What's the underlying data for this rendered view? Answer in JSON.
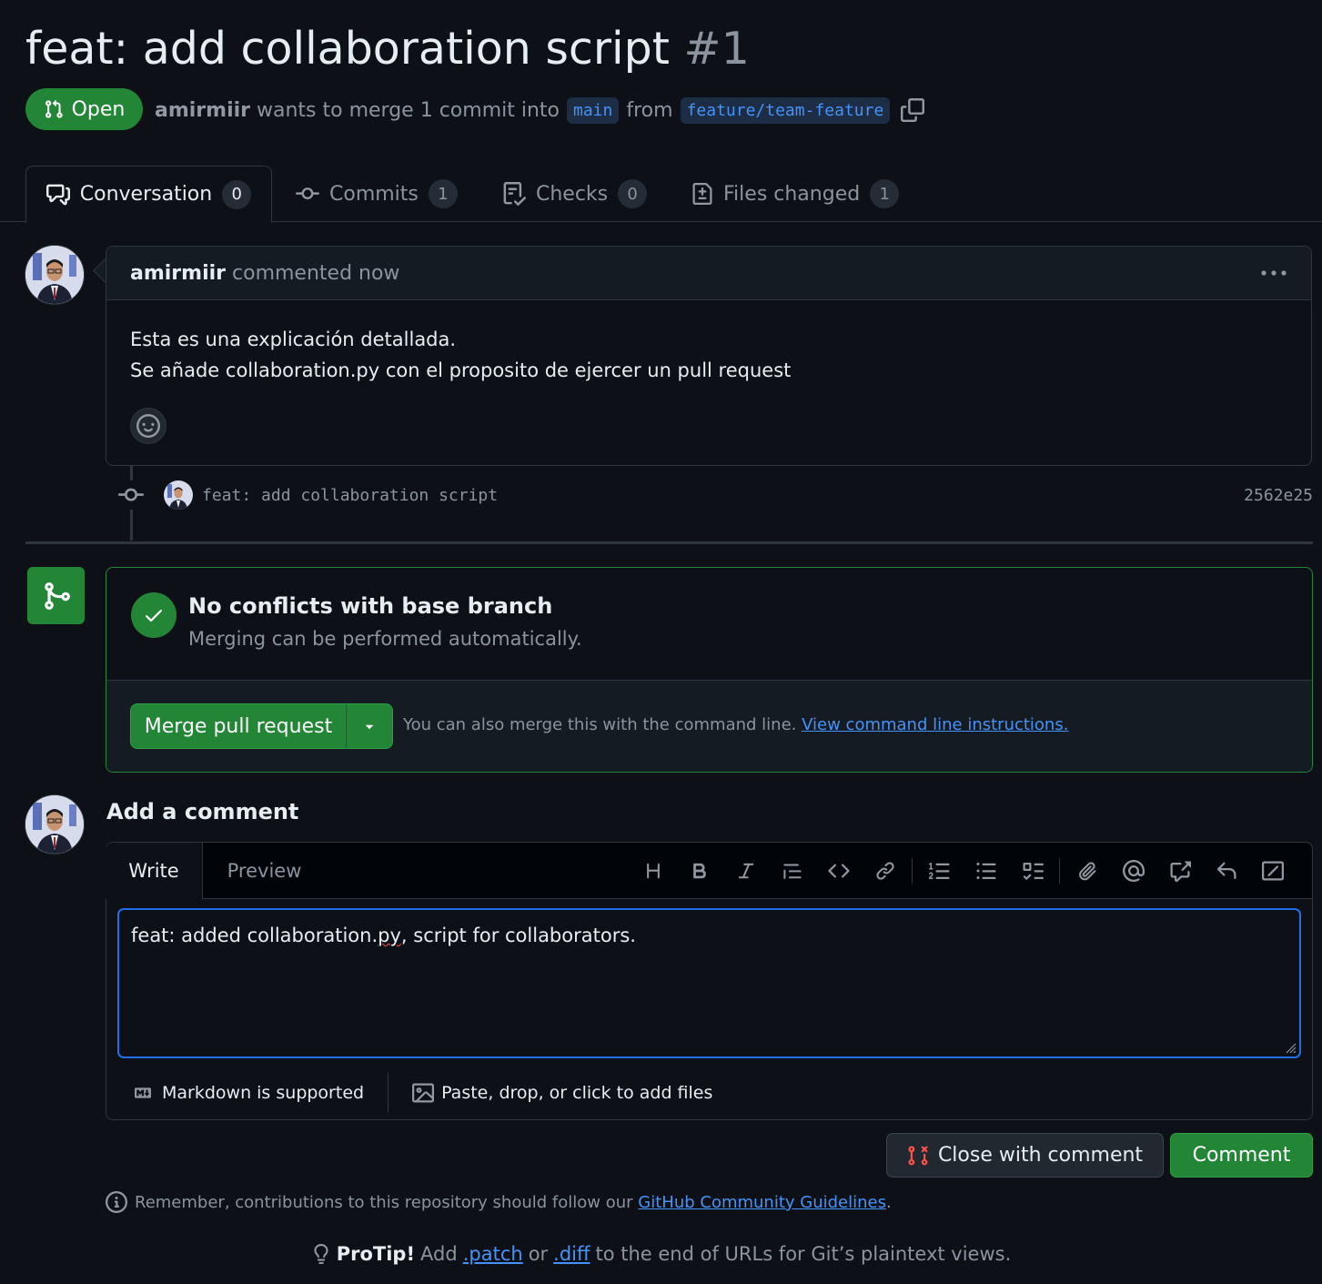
{
  "pr": {
    "title": "feat: add collaboration script",
    "number": "#1",
    "state": "Open",
    "author": "amirmiir",
    "meta_text": "wants to merge 1 commit into",
    "base_branch": "main",
    "from_text": "from",
    "head_branch": "feature/team-feature"
  },
  "tabs": [
    {
      "label": "Conversation",
      "count": "0",
      "icon": "comment-discussion-icon"
    },
    {
      "label": "Commits",
      "count": "1",
      "icon": "git-commit-icon"
    },
    {
      "label": "Checks",
      "count": "0",
      "icon": "checklist-icon"
    },
    {
      "label": "Files changed",
      "count": "1",
      "icon": "file-diff-icon"
    }
  ],
  "comment": {
    "author": "amirmiir",
    "action": "commented now",
    "body_line1": "Esta es una explicación detallada.",
    "body_line2": "Se añade collaboration.py con el proposito de ejercer un pull request"
  },
  "commit": {
    "message": "feat: add collaboration script",
    "sha": "2562e25"
  },
  "merge": {
    "title": "No conflicts with base branch",
    "subtitle": "Merging can be performed automatically.",
    "button": "Merge pull request",
    "hint": "You can also merge this with the command line.",
    "hint_link": "View command line instructions."
  },
  "add_comment": {
    "title": "Add a comment",
    "tab_write": "Write",
    "tab_preview": "Preview",
    "text_before": "feat: added collaboration.",
    "text_misspelled": "py",
    "text_after": ", script for collaborators.",
    "markdown_note": "Markdown is supported",
    "attach_note": "Paste, drop, or click to add files",
    "toolbar_icons": [
      "heading-icon",
      "bold-icon",
      "italic-icon",
      "quote-icon",
      "code-icon",
      "link-icon",
      "ordered-list-icon",
      "unordered-list-icon",
      "task-list-icon",
      "attach-icon",
      "mention-icon",
      "cross-reference-icon",
      "undo-icon",
      "slash-command-icon"
    ]
  },
  "actions": {
    "close_with_comment": "Close with comment",
    "comment": "Comment"
  },
  "footer": {
    "remember": "Remember, contributions to this repository should follow our",
    "guidelines_link": "GitHub Community Guidelines",
    "period": ".",
    "protip_label": "ProTip!",
    "protip_add": "Add",
    "patch": ".patch",
    "or": "or",
    "diff": ".diff",
    "protip_rest": "to the end of URLs for Git’s plaintext views."
  },
  "colors": {
    "background": "#0d1117",
    "success": "#238636",
    "link": "#4493f8",
    "muted": "#8b949e"
  }
}
